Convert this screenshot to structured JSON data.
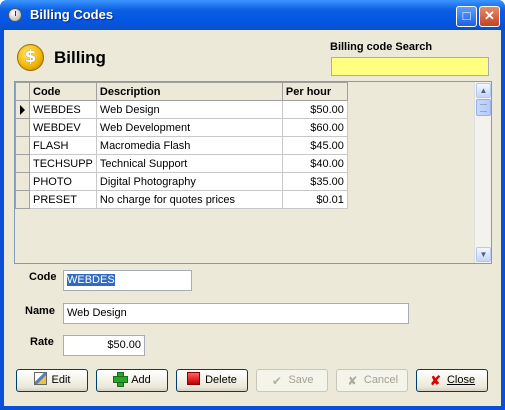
{
  "window": {
    "title": "Billing Codes",
    "maximize_glyph": "□",
    "close_glyph": "✕"
  },
  "header": {
    "coin_glyph": "$",
    "title": "Billing",
    "search_label": "Billing code Search",
    "search_value": ""
  },
  "grid": {
    "columns": [
      "Code",
      "Description",
      "Per hour"
    ],
    "rows": [
      {
        "code": "WEBDES",
        "description": "Web Design",
        "rate": "$50.00",
        "current": true
      },
      {
        "code": "WEBDEV",
        "description": "Web Development",
        "rate": "$60.00"
      },
      {
        "code": "FLASH",
        "description": "Macromedia Flash",
        "rate": "$45.00"
      },
      {
        "code": "TECHSUPP",
        "description": "Technical Support",
        "rate": "$40.00"
      },
      {
        "code": "PHOTO",
        "description": "Digital Photography",
        "rate": "$35.00"
      },
      {
        "code": "PRESET",
        "description": "No charge for quotes prices",
        "rate": "$0.01"
      }
    ],
    "scroll_up_glyph": "▲",
    "scroll_down_glyph": "▼"
  },
  "form": {
    "code_label": "Code",
    "code_value": "WEBDES",
    "name_label": "Name",
    "name_value": "Web Design",
    "rate_label": "Rate",
    "rate_value": "$50.00"
  },
  "buttons": {
    "edit": "Edit",
    "add": "Add",
    "delete": "Delete",
    "save": "Save",
    "cancel": "Cancel",
    "close": "Close",
    "save_glyph": "✔",
    "cancel_glyph": "✘",
    "close_glyph": "✘"
  },
  "icons": {
    "title": "stopwatch-icon",
    "billing": "dollar-coin-icon",
    "current_row": "row-pointer-icon",
    "edit": "edit-icon",
    "add": "add-icon",
    "delete": "delete-icon",
    "save": "checkmark-icon",
    "cancel": "cancel-icon",
    "close": "close-icon"
  },
  "colors": {
    "title_bar": "#0456e5",
    "search_highlight": "#ffff80",
    "selection": "#316ac5",
    "face": "#ece9d8"
  }
}
